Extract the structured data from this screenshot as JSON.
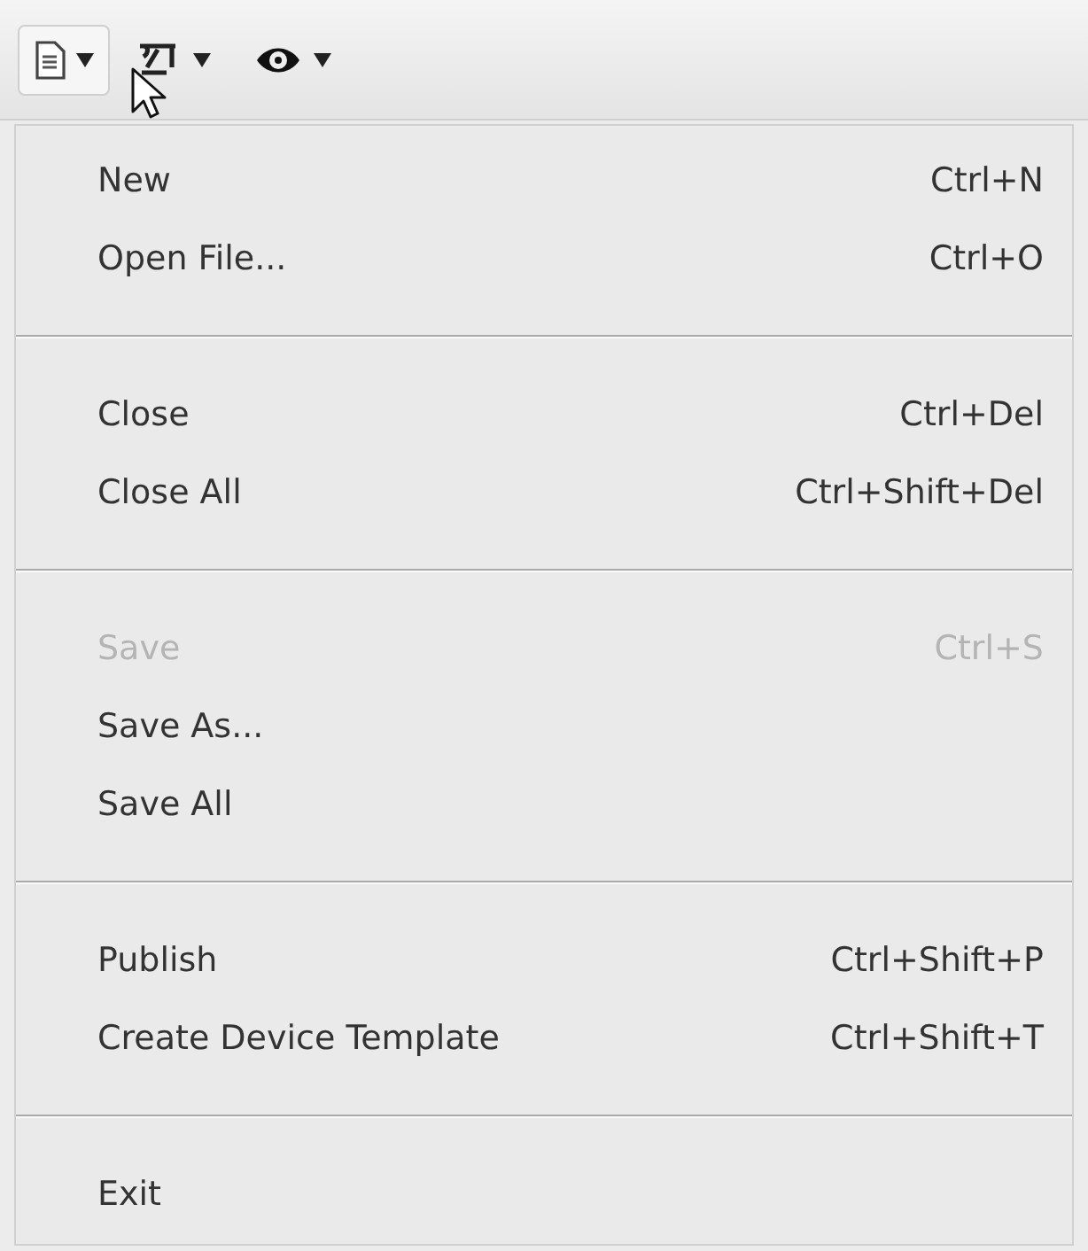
{
  "toolbar": {
    "buttons": [
      {
        "selected": true
      },
      {
        "selected": false
      },
      {
        "selected": false
      }
    ]
  },
  "menu": {
    "groups": [
      {
        "items": [
          {
            "label": "New",
            "shortcut": "Ctrl+N",
            "disabled": false
          },
          {
            "label": "Open File...",
            "shortcut": "Ctrl+O",
            "disabled": false
          }
        ]
      },
      {
        "items": [
          {
            "label": "Close",
            "shortcut": "Ctrl+Del",
            "disabled": false
          },
          {
            "label": "Close All",
            "shortcut": "Ctrl+Shift+Del",
            "disabled": false
          }
        ]
      },
      {
        "items": [
          {
            "label": "Save",
            "shortcut": "Ctrl+S",
            "disabled": true
          },
          {
            "label": "Save As...",
            "disabled": false
          },
          {
            "label": "Save All",
            "disabled": false
          }
        ]
      },
      {
        "items": [
          {
            "label": "Publish",
            "shortcut": "Ctrl+Shift+P",
            "disabled": false
          },
          {
            "label": "Create Device Template",
            "shortcut": "Ctrl+Shift+T",
            "disabled": false
          }
        ]
      },
      {
        "items": [
          {
            "label": "Exit",
            "disabled": false
          }
        ]
      }
    ]
  }
}
